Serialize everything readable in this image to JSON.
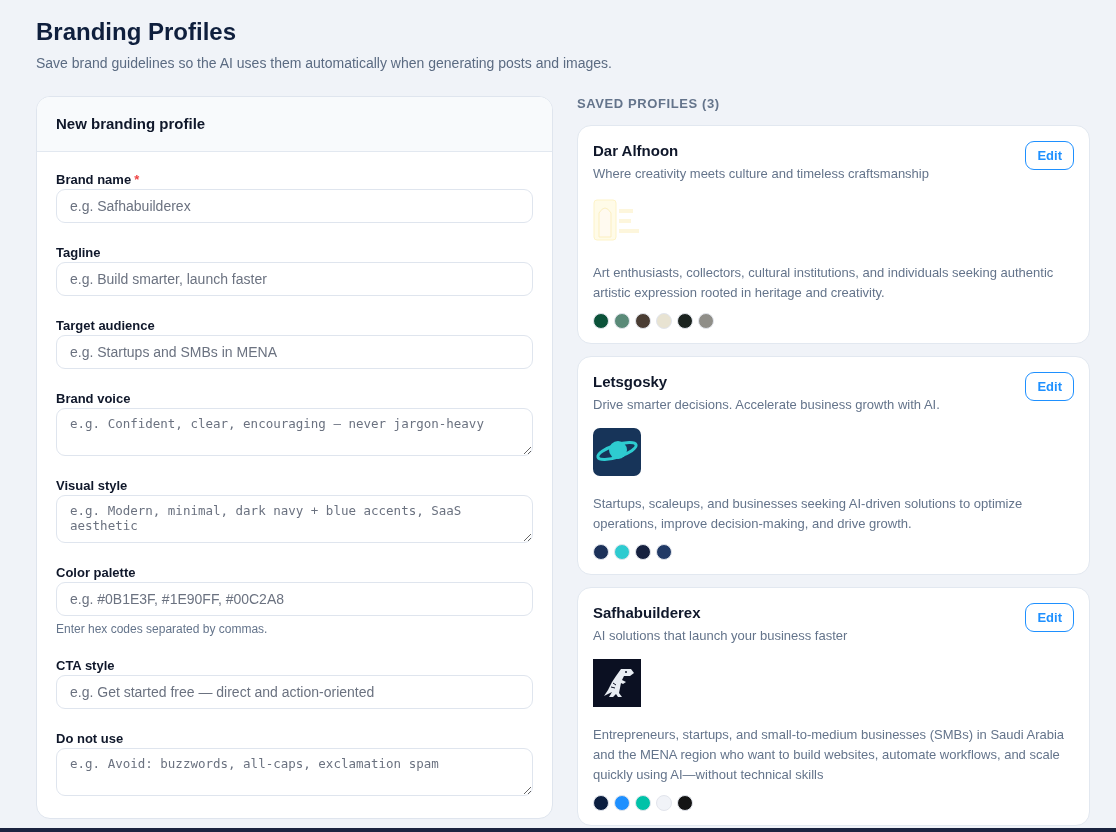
{
  "header": {
    "title": "Branding Profiles",
    "subtitle": "Save brand guidelines so the AI uses them automatically when generating posts and images."
  },
  "form": {
    "title": "New branding profile",
    "fields": [
      {
        "label": "Brand name",
        "required_mark": "*",
        "kind": "input",
        "placeholder": "e.g. Safhabuilderex"
      },
      {
        "label": "Tagline",
        "kind": "input",
        "placeholder": "e.g. Build smarter, launch faster"
      },
      {
        "label": "Target audience",
        "kind": "input",
        "placeholder": "e.g. Startups and SMBs in MENA"
      },
      {
        "label": "Brand voice",
        "kind": "textarea",
        "placeholder": "e.g. Confident, clear, encouraging — never jargon-heavy"
      },
      {
        "label": "Visual style",
        "kind": "textarea",
        "placeholder": "e.g. Modern, minimal, dark navy + blue accents, SaaS aesthetic"
      },
      {
        "label": "Color palette",
        "kind": "input",
        "placeholder": "e.g. #0B1E3F, #1E90FF, #00C2A8",
        "hint": "Enter hex codes separated by commas."
      },
      {
        "label": "CTA style",
        "kind": "input",
        "placeholder": "e.g. Get started free — direct and action-oriented"
      },
      {
        "label": "Do not use",
        "kind": "textarea",
        "placeholder": "e.g. Avoid: buzzwords, all-caps, exclamation spam"
      }
    ]
  },
  "saved": {
    "heading": "SAVED PROFILES (3)",
    "profiles": [
      {
        "name": "Dar Alfnoon",
        "tagline": "Where creativity meets culture and timeless craftsmanship",
        "logo": {
          "kind": "picture"
        },
        "audience": "Art enthusiasts, collectors, cultural institutions, and individuals seeking authentic artistic expression rooted in heritage and creativity.",
        "edit": "Edit",
        "colors": [
          {
            "color": "#0b5239"
          },
          {
            "color": "#5a8a78"
          },
          {
            "color": "#4a3d33"
          },
          {
            "color": "#e8e3d2"
          },
          {
            "color": "#1b231f"
          },
          {
            "color": "#8f8e88"
          }
        ]
      },
      {
        "name": "Letsgosky",
        "tagline": "Drive smarter decisions. Accelerate business growth with AI.",
        "logo": {
          "kind": "picture"
        },
        "audience": "Startups, scaleups, and businesses seeking AI-driven solutions to optimize operations, improve decision-making, and drive growth.",
        "edit": "Edit",
        "colors": [
          {
            "color": "#1c3159"
          },
          {
            "color": "#2ecbd0"
          },
          {
            "color": "#16213f"
          },
          {
            "color": "#213a66"
          }
        ]
      },
      {
        "name": "Safhabuilderex",
        "tagline": "AI solutions that launch your business faster",
        "logo": {
          "kind": "picture"
        },
        "audience": "Entrepreneurs, startups, and small-to-medium businesses (SMBs) in Saudi Arabia and the MENA region who want to build websites, automate workflows, and scale quickly using AI—without technical skills",
        "edit": "Edit",
        "colors": [
          {
            "color": "#0b1e3f"
          },
          {
            "color": "#1e90ff"
          },
          {
            "color": "#00c2a8"
          },
          {
            "color": "#f1f3f8"
          },
          {
            "color": "#141414"
          }
        ]
      }
    ]
  }
}
